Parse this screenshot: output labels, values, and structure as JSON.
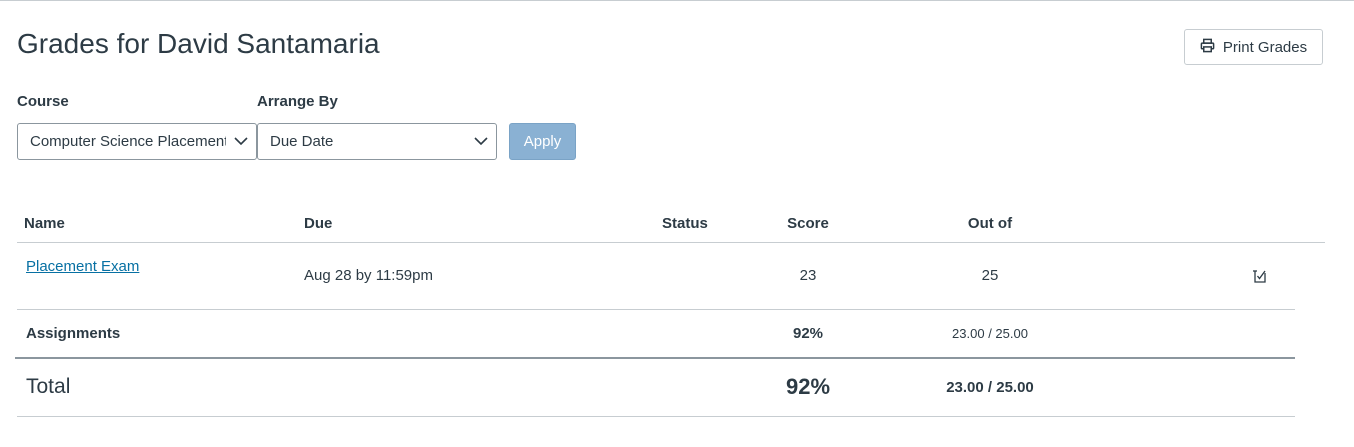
{
  "page": {
    "title": "Grades for David Santamaria"
  },
  "toolbar": {
    "print_label": "Print Grades",
    "print_icon": "printer-icon"
  },
  "filters": {
    "course_label": "Course",
    "course_value": "Computer Science Placement",
    "arrange_label": "Arrange By",
    "arrange_value": "Due Date",
    "apply_label": "Apply"
  },
  "table": {
    "headers": {
      "name": "Name",
      "due": "Due",
      "status": "Status",
      "score": "Score",
      "out_of": "Out of"
    },
    "rows": [
      {
        "name": "Placement Exam",
        "due": "Aug 28 by 11:59pm",
        "status": "",
        "score": "23",
        "out_of": "25",
        "icon": "rubric-check-icon"
      }
    ],
    "group": {
      "name": "Assignments",
      "score": "92%",
      "out_of": "23.00 / 25.00"
    },
    "total": {
      "name": "Total",
      "score": "92%",
      "out_of": "23.00 / 25.00"
    }
  },
  "colors": {
    "link": "#0770a3",
    "text": "#2d3b45",
    "apply_bg": "#8ab1d3",
    "border": "#c7cdd1"
  }
}
